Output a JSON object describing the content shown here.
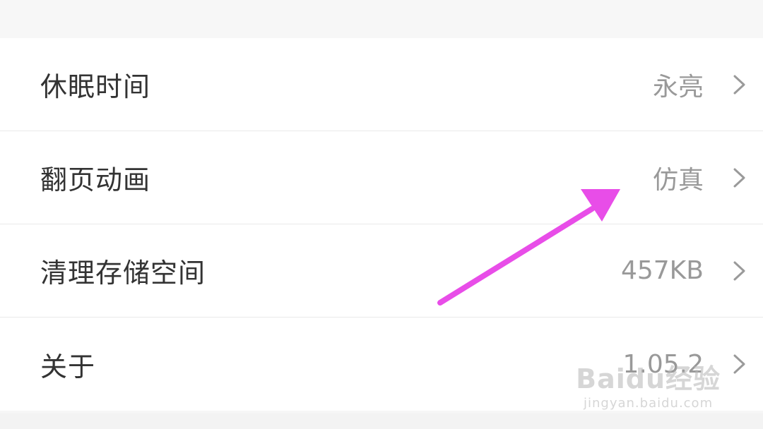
{
  "settings": {
    "items": [
      {
        "label": "休眠时间",
        "value": "永亮"
      },
      {
        "label": "翻页动画",
        "value": "仿真"
      },
      {
        "label": "清理存储空间",
        "value": "457KB"
      },
      {
        "label": "关于",
        "value": "1.05.2"
      }
    ]
  },
  "chevron_icon": "chevron-right-icon",
  "annotation": {
    "color": "#e84de8",
    "icon": "arrow-annotation"
  },
  "watermark": {
    "brand": "Baidu经验",
    "url": "jingyan.baidu.com"
  }
}
